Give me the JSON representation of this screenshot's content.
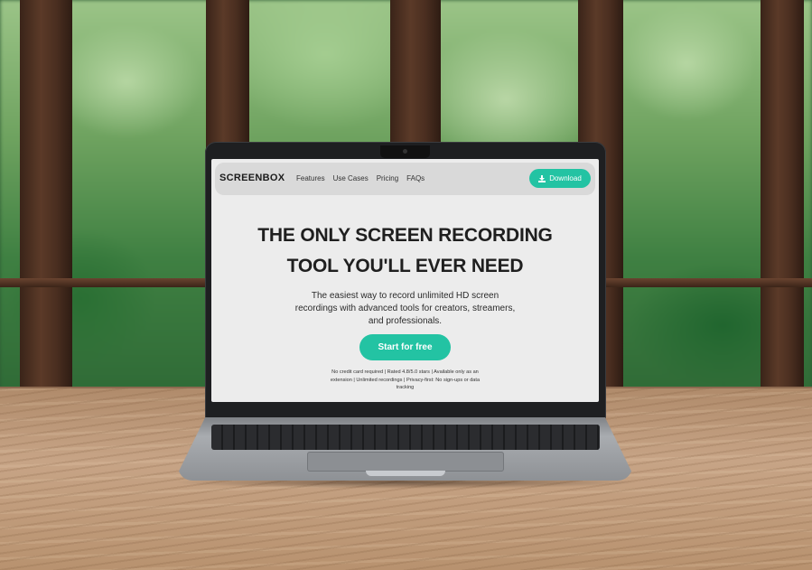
{
  "site": {
    "brand": "SCREENBOX",
    "nav_links": [
      "Features",
      "Use Cases",
      "Pricing",
      "FAQs"
    ],
    "download_label": "Download",
    "headline_line1": "THE ONLY SCREEN RECORDING",
    "headline_line2": "TOOL YOU'LL EVER NEED",
    "subheading_line1": "The easiest way to record unlimited HD screen",
    "subheading_line2": "recordings with advanced tools for creators, streamers,",
    "subheading_line3": "and professionals.",
    "cta_label": "Start for free",
    "fine_print_line1": "No credit card required | Rated 4.8/5.0 stars | Available only as an",
    "fine_print_line2": "extension | Unlimited recordings | Privacy-first: No sign-ups or data",
    "fine_print_line3": "tracking"
  },
  "colors": {
    "accent": "#23c3a3",
    "nav_bg": "#d9d9d9",
    "page_bg": "#ececec",
    "text": "#1f1f1f"
  },
  "icons": {
    "download": "download-icon"
  }
}
